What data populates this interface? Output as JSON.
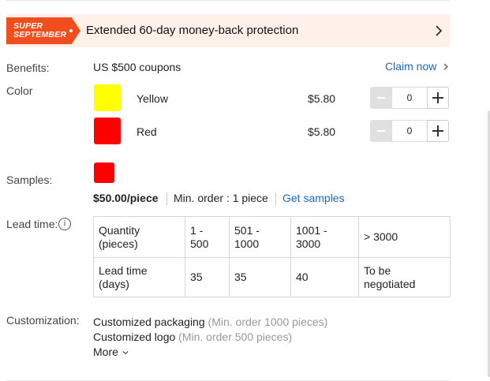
{
  "promo": {
    "badge_line1": "SUPER",
    "badge_line2": "SEPTEMBER",
    "text": "Extended 60-day money-back protection",
    "badge_color": "#f24d1c",
    "background": "#fff1ea"
  },
  "benefits": {
    "label": "Benefits:",
    "value": "US $500 coupons",
    "action": "Claim now"
  },
  "color": {
    "label": "Color",
    "options": [
      {
        "name": "Yellow",
        "price": "$5.80",
        "quantity": "0",
        "swatch": "#ffff00"
      },
      {
        "name": "Red",
        "price": "$5.80",
        "quantity": "0",
        "swatch": "#ff0000"
      }
    ]
  },
  "samples": {
    "label": "Samples:",
    "swatch": "#ff0000",
    "price": "$50.00/piece",
    "min_order": "Min. order : 1 piece",
    "action": "Get samples"
  },
  "lead_time": {
    "label": "Lead time:",
    "info_glyph": "i",
    "rows": [
      [
        "Quantity (pieces)",
        "1 - 500",
        "501 - 1000",
        "1001 - 3000",
        "> 3000"
      ],
      [
        "Lead time (days)",
        "35",
        "35",
        "40",
        "To be negotiated"
      ]
    ]
  },
  "customization": {
    "label": "Customization:",
    "items": [
      {
        "name": "Customized packaging",
        "note": "(Min. order 1000 pieces)"
      },
      {
        "name": "Customized logo",
        "note": "(Min. order 500 pieces)"
      }
    ],
    "more": "More"
  },
  "accent_color": "#1a66c9"
}
